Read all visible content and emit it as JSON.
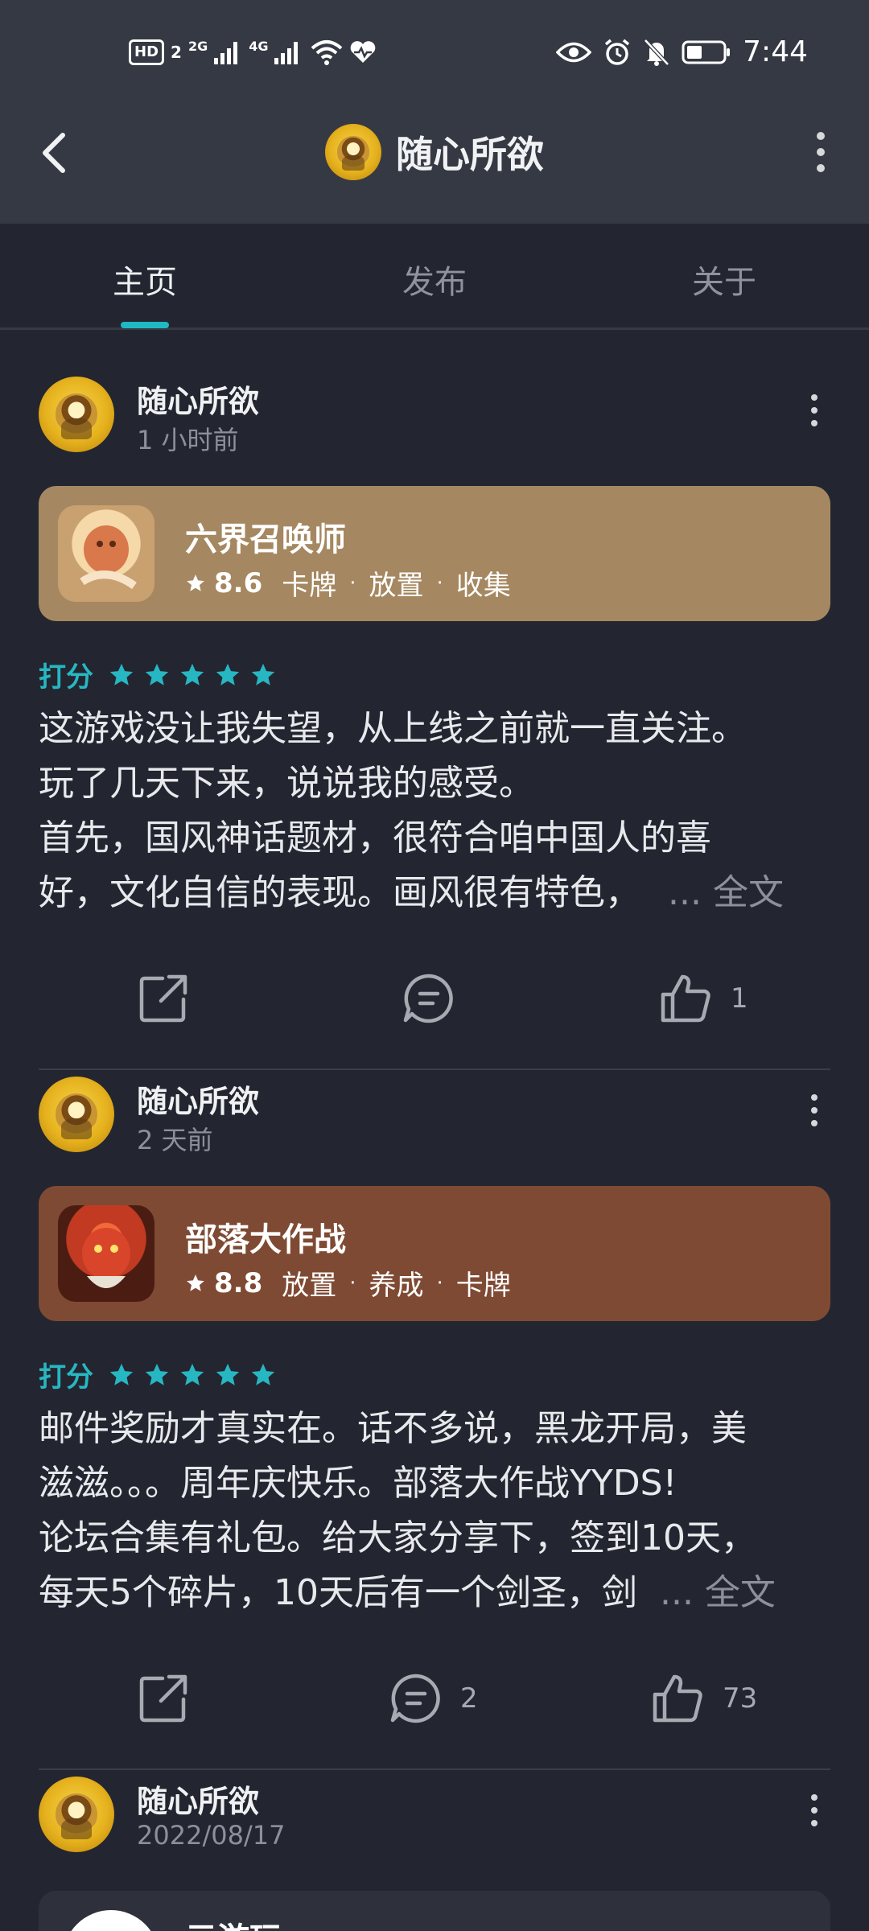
{
  "status_bar": {
    "hd": "HD",
    "sim": "2",
    "net1": "2G",
    "net2": "4G",
    "time": "7:44"
  },
  "header": {
    "title": "随心所欲"
  },
  "tabs": [
    {
      "label": "主页",
      "active": true
    },
    {
      "label": "发布",
      "active": false
    },
    {
      "label": "关于",
      "active": false
    }
  ],
  "posts": [
    {
      "author": "随心所欲",
      "time": "1 小时前",
      "game": {
        "name": "六界召唤师",
        "score": "8.6",
        "tags": [
          "卡牌",
          "放置",
          "收集"
        ],
        "card_color": "#a58861"
      },
      "rating_label": "打分",
      "stars": 5,
      "text_lines": [
        "这游戏没让我失望，从上线之前就一直关注。",
        "玩了几天下来，说说我的感受。",
        "首先，国风神话题材，很符合咱中国人的喜",
        "好，文化自信的表现。画风很有特色，"
      ],
      "more": "... 全文",
      "comments": "",
      "likes": "1"
    },
    {
      "author": "随心所欲",
      "time": "2 天前",
      "game": {
        "name": "部落大作战",
        "score": "8.8",
        "tags": [
          "放置",
          "养成",
          "卡牌"
        ],
        "card_color": "#7f4a33"
      },
      "rating_label": "打分",
      "stars": 5,
      "text_lines": [
        "邮件奖励才真实在。话不多说，黑龙开局，美",
        "滋滋。。。周年庆快乐。部落大作战YYDS!",
        "论坛合集有礼包。给大家分享下，签到10天，",
        "每天5个碎片，10天后有一个剑圣，剑"
      ],
      "more": "... 全文",
      "comments": "2",
      "likes": "73"
    },
    {
      "author": "随心所欲",
      "time": "2022/08/17",
      "game": {
        "name": "元游玩"
      }
    }
  ],
  "colors": {
    "accent": "#1fb9c4",
    "background": "#232630",
    "header": "#353943"
  }
}
